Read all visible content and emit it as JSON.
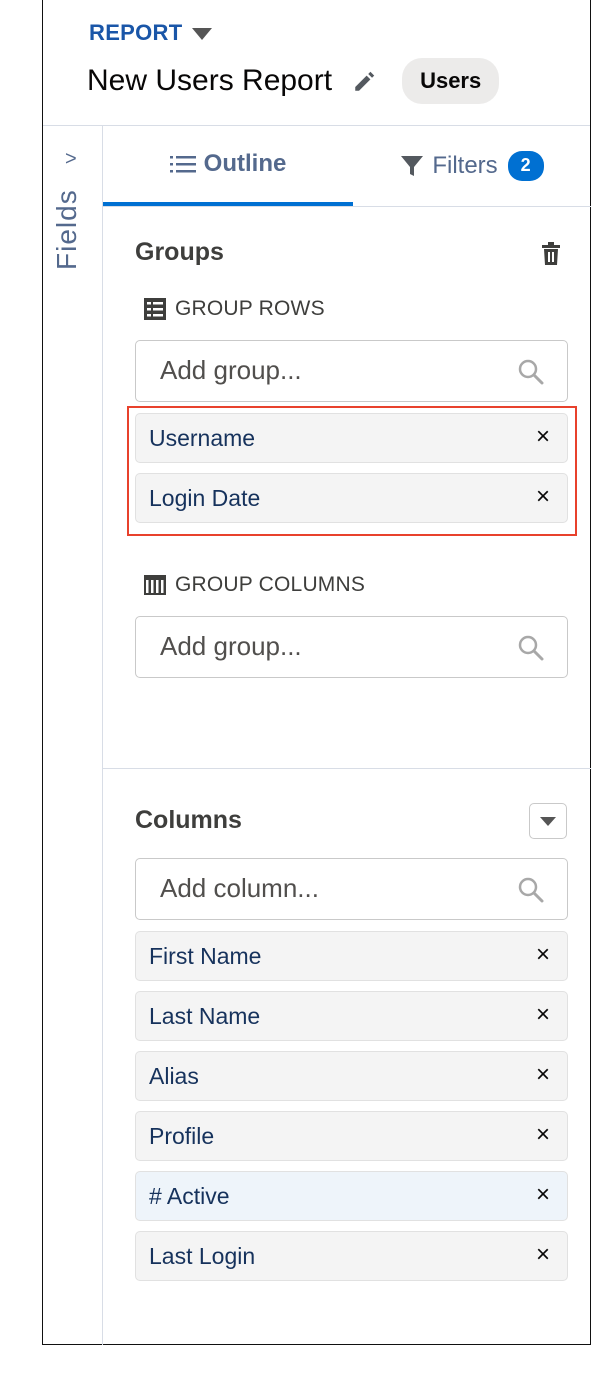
{
  "header": {
    "report_label": "REPORT",
    "title": "New Users Report",
    "object_badge": "Users"
  },
  "side": {
    "fields_label": "Fields",
    "chevron": ">"
  },
  "tabs": [
    {
      "label": "Outline",
      "icon": "list-icon"
    },
    {
      "label": "Filters",
      "icon": "filter-icon",
      "count": "2"
    }
  ],
  "groups": {
    "title": "Groups",
    "rows": {
      "label": "GROUP ROWS",
      "placeholder": "Add group...",
      "items": [
        "Username",
        "Login Date"
      ]
    },
    "columns": {
      "label": "GROUP COLUMNS",
      "placeholder": "Add group..."
    }
  },
  "columns": {
    "title": "Columns",
    "placeholder": "Add column...",
    "items": [
      {
        "label": "First Name"
      },
      {
        "label": "Last Name"
      },
      {
        "label": "Alias"
      },
      {
        "label": "Profile"
      },
      {
        "label": "# Active"
      },
      {
        "label": "Last Login"
      }
    ]
  },
  "icons": {
    "remove": "×"
  },
  "colors": {
    "accent": "#0070d2",
    "highlight_border": "#e8412c"
  }
}
